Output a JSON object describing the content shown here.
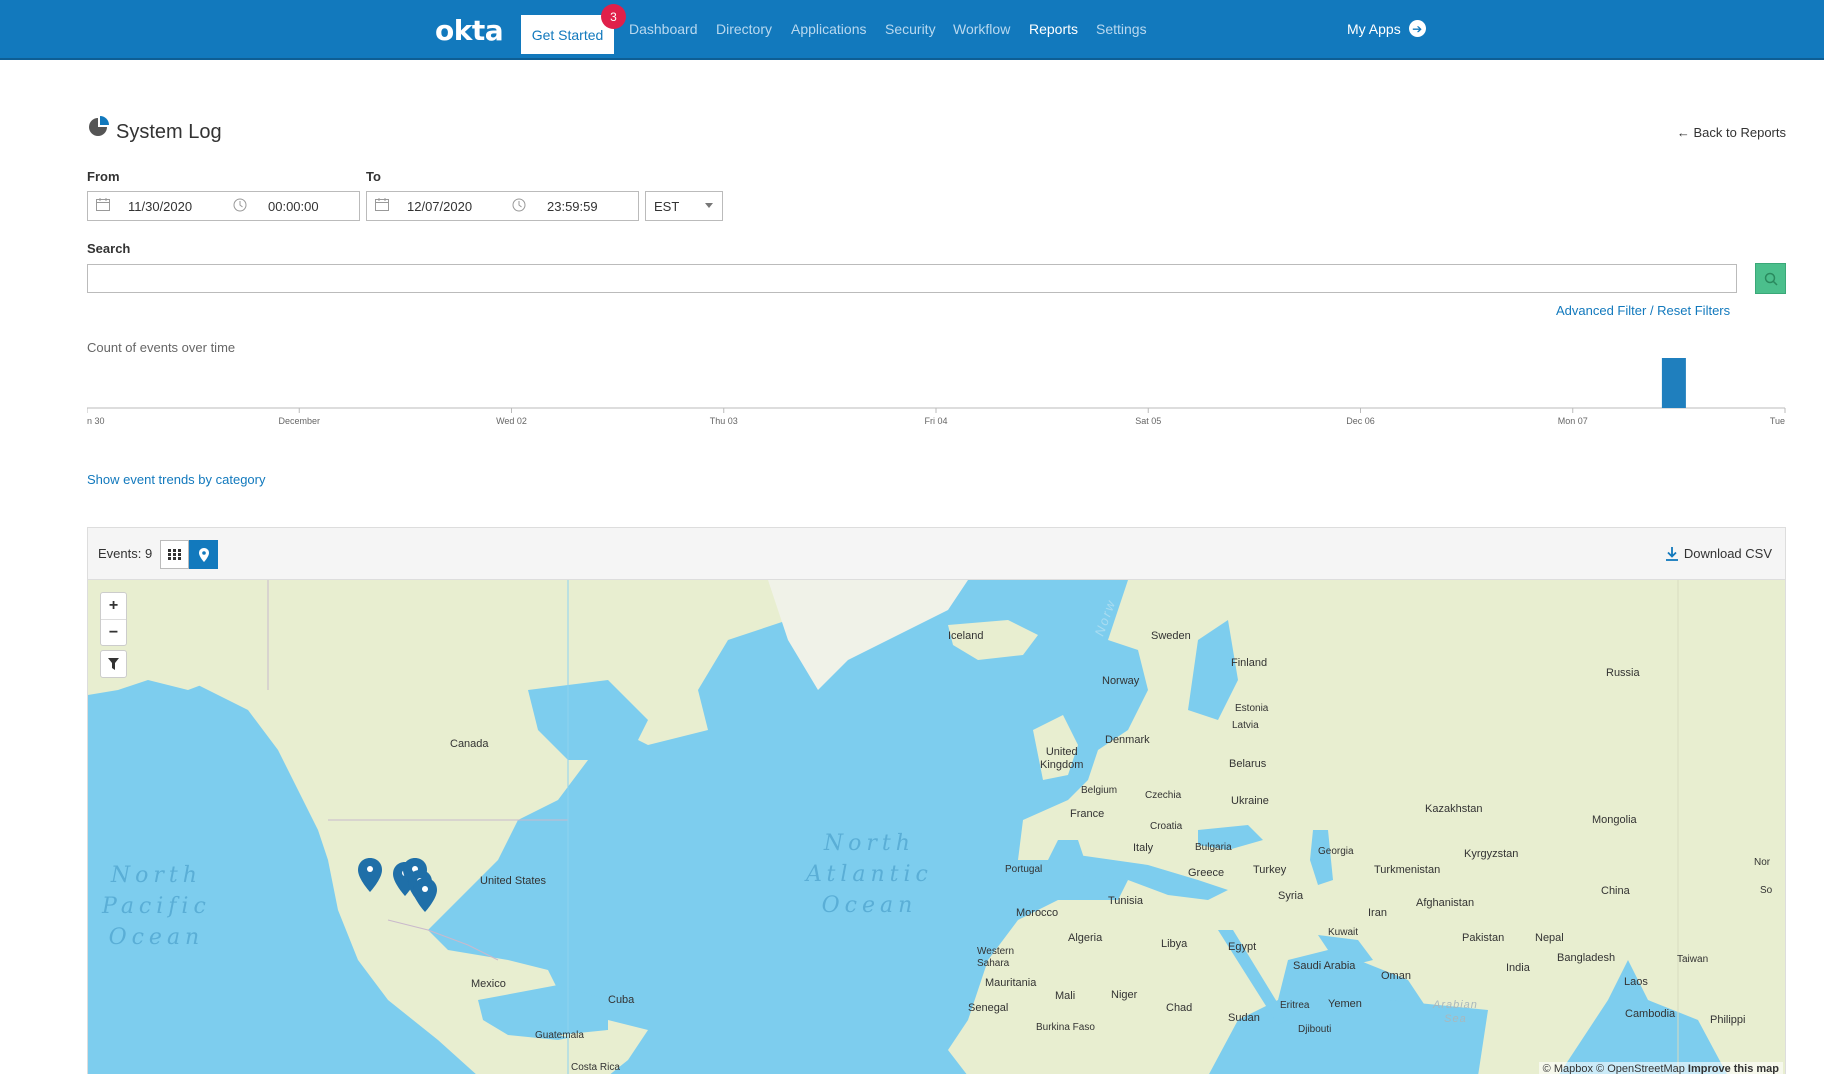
{
  "nav": {
    "logo": "okta",
    "get_started": "Get Started",
    "badge_count": "3",
    "items": [
      "Dashboard",
      "Directory",
      "Applications",
      "Security",
      "Workflow",
      "Reports",
      "Settings"
    ],
    "active": "Reports",
    "my_apps": "My Apps"
  },
  "header": {
    "title": "System Log",
    "back_link": "← Back to Reports"
  },
  "filters": {
    "from_label": "From",
    "to_label": "To",
    "from_date": "11/30/2020",
    "from_time": "00:00:00",
    "to_date": "12/07/2020",
    "to_time": "23:59:59",
    "timezone": "EST",
    "search_label": "Search",
    "search_value": "",
    "advanced_filter": "Advanced Filter",
    "separator": " / ",
    "reset_filters": "Reset Filters"
  },
  "chart_data": {
    "type": "bar",
    "title": "Count of events over time",
    "x_ticks": [
      "n 30",
      "December",
      "Wed 02",
      "Thu 03",
      "Fri 04",
      "Sat 05",
      "Dec 06",
      "Mon 07",
      "Tue"
    ],
    "bars": [
      {
        "x_day": 7.42,
        "value": 9
      }
    ],
    "x_range": [
      0,
      8
    ],
    "y_range": [
      0,
      9
    ],
    "bar_color": "#1f7fbe"
  },
  "trends_link": "Show event trends by category",
  "events": {
    "label": "Events: ",
    "count": "9",
    "download_csv": "Download CSV",
    "view_toggle_active": "map"
  },
  "map": {
    "labels": {
      "canada": "Canada",
      "united_states": "United States",
      "mexico": "Mexico",
      "cuba": "Cuba",
      "guatemala": "Guatemala",
      "costa_rica": "Costa Rica",
      "iceland": "Iceland",
      "sweden": "Sweden",
      "finland": "Finland",
      "norway": "Norway",
      "estonia": "Estonia",
      "latvia": "Latvia",
      "denmark": "Denmark",
      "united_kingdom": "United\nKingdom",
      "belarus": "Belarus",
      "belgium": "Belgium",
      "czechia": "Czechia",
      "ukraine": "Ukraine",
      "france": "France",
      "croatia": "Croatia",
      "italy": "Italy",
      "bulgaria": "Bulgaria",
      "georgia": "Georgia",
      "portugal": "Portugal",
      "greece": "Greece",
      "turkey": "Turkey",
      "tunisia": "Tunisia",
      "syria": "Syria",
      "morocco": "Morocco",
      "algeria": "Algeria",
      "libya": "Libya",
      "egypt": "Egypt",
      "western_sahara": "Western\nSahara",
      "mauritania": "Mauritania",
      "mali": "Mali",
      "niger": "Niger",
      "chad": "Chad",
      "sudan": "Sudan",
      "senegal": "Senegal",
      "burkina_faso": "Burkina Faso",
      "eritrea": "Eritrea",
      "djibouti": "Djibouti",
      "yemen": "Yemen",
      "saudi_arabia": "Saudi Arabia",
      "oman": "Oman",
      "kuwait": "Kuwait",
      "iran": "Iran",
      "afghanistan": "Afghanistan",
      "pakistan": "Pakistan",
      "turkmenistan": "Turkmenistan",
      "kazakhstan": "Kazakhstan",
      "kyrgyzstan": "Kyrgyzstan",
      "russia": "Russia",
      "mongolia": "Mongolia",
      "china": "China",
      "nepal": "Nepal",
      "india": "India",
      "bangladesh": "Bangladesh",
      "laos": "Laos",
      "taiwan": "Taiwan",
      "cambodia": "Cambodia",
      "philippines": "Philippi",
      "nor": "Nor",
      "so": "So",
      "arabian_sea": "Arabian\nSea",
      "norw": "Norw"
    },
    "oceans": {
      "north_pacific": "North\nPacific\nOcean",
      "north_atlantic": "North\nAtlantic\nOcean"
    },
    "attribution": {
      "mapbox": "© Mapbox",
      "osm": "© OpenStreetMap",
      "improve": "Improve this map"
    }
  }
}
